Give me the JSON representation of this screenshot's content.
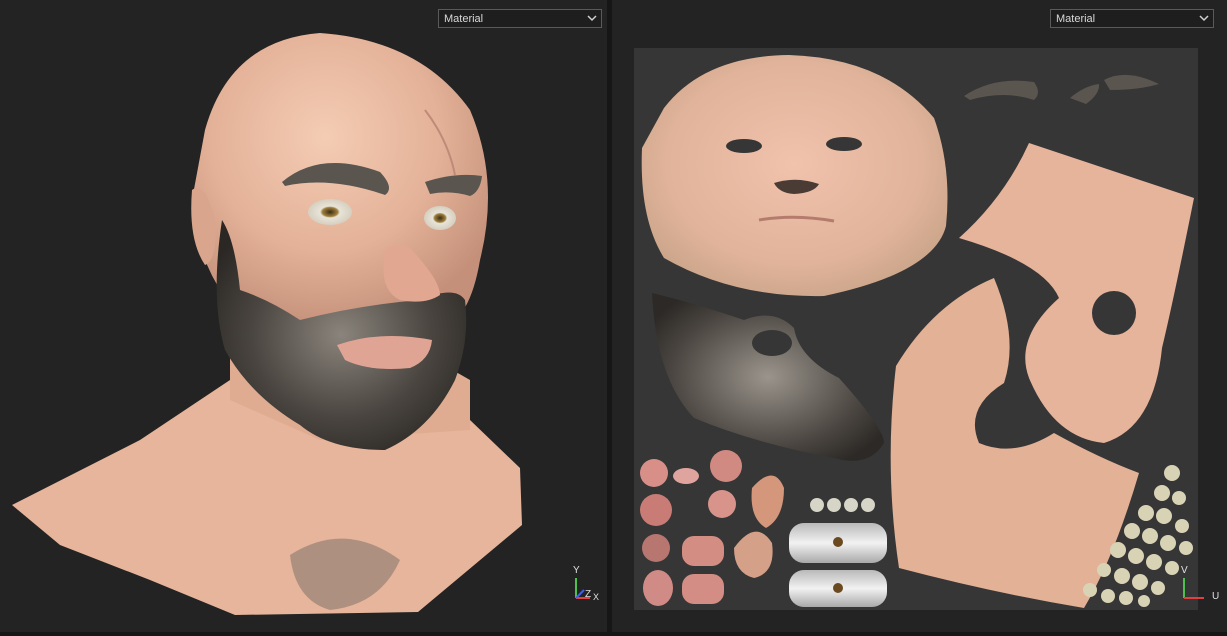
{
  "left_viewport": {
    "shading_mode": "Material",
    "gizmo": {
      "y": "Y",
      "z": "Z",
      "x": "X"
    }
  },
  "right_viewport": {
    "shading_mode": "Material",
    "gizmo": {
      "v": "V",
      "u": "U"
    }
  },
  "colors": {
    "panel_bg": "#232323",
    "uv_bg": "#363636",
    "skin": "#e9b89c",
    "beard": "#4a4540",
    "axis_x": "#e04040",
    "axis_y": "#4fc04f"
  }
}
